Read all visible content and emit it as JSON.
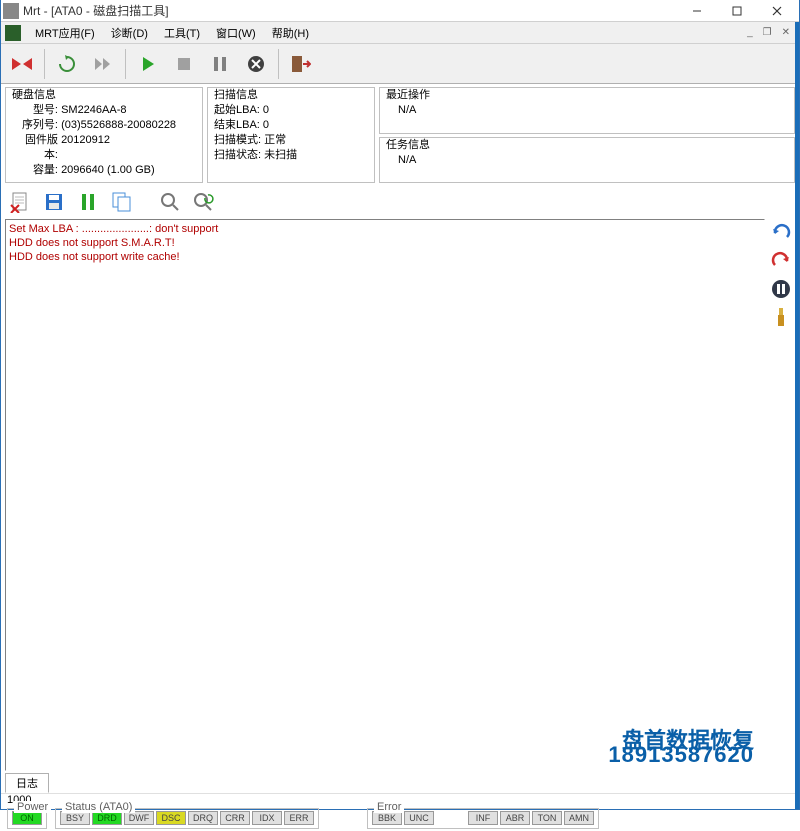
{
  "window": {
    "title": "Mrt - [ATA0 - 磁盘扫描工具]"
  },
  "menus": {
    "app": "MRT应用(F)",
    "diag": "诊断(D)",
    "tools": "工具(T)",
    "window": "窗口(W)",
    "help": "帮助(H)"
  },
  "disk_info": {
    "legend": "硬盘信息",
    "model_k": "型号:",
    "model_v": "SM2246AA-8",
    "serial_k": "序列号:",
    "serial_v": "(03)5526888-20080228",
    "fw_k": "固件版本:",
    "fw_v": "20120912",
    "cap_k": "容量:",
    "cap_v": "2096640 (1.00 GB)"
  },
  "scan_info": {
    "legend": "扫描信息",
    "start_k": "起始LBA:",
    "start_v": "0",
    "end_k": "结束LBA:",
    "end_v": "0",
    "mode_k": "扫描模式:",
    "mode_v": "正常",
    "state_k": "扫描状态:",
    "state_v": "未扫描"
  },
  "recent": {
    "legend": "最近操作",
    "value": "N/A"
  },
  "task": {
    "legend": "任务信息",
    "value": "N/A"
  },
  "log": {
    "line1": "Set Max LBA : ......................: don't support",
    "line2": "HDD does not support S.M.A.R.T!",
    "line3": "HDD does not support write cache!"
  },
  "watermark": {
    "text1": "盘首数据恢复",
    "text2": "18913587620"
  },
  "tab": {
    "label": "日志"
  },
  "counter": {
    "value": "1000"
  },
  "status": {
    "power_legend": "Power",
    "power_on": "ON",
    "status_legend": "Status (ATA0)",
    "bsy": "BSY",
    "drd": "DRD",
    "dwf": "DWF",
    "dsc": "DSC",
    "drq": "DRQ",
    "crr": "CRR",
    "idx": "IDX",
    "err": "ERR",
    "error_legend": "Error",
    "bbk": "BBK",
    "unc": "UNC",
    "inf": "INF",
    "abr": "ABR",
    "ton": "TON",
    "amn": "AMN"
  }
}
